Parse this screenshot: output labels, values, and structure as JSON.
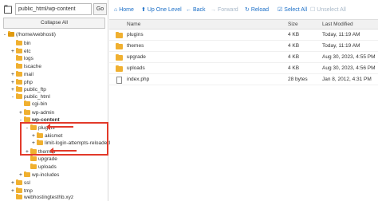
{
  "path_bar": {
    "value": "public_html/wp-content",
    "go_label": "Go"
  },
  "collapse_label": "Collapse All",
  "tree": [
    {
      "toggle": "-",
      "label": "(/home/webhosti)",
      "bold": false
    },
    {
      "toggle": "",
      "label": "bin",
      "bold": false
    },
    {
      "toggle": "+",
      "label": "etc",
      "bold": false
    },
    {
      "toggle": "",
      "label": "logs",
      "bold": false
    },
    {
      "toggle": "",
      "label": "lscache",
      "bold": false
    },
    {
      "toggle": "+",
      "label": "mail",
      "bold": false
    },
    {
      "toggle": "+",
      "label": "php",
      "bold": false
    },
    {
      "toggle": "+",
      "label": "public_ftp",
      "bold": false
    },
    {
      "toggle": "-",
      "label": "public_html",
      "bold": false
    },
    {
      "toggle": "",
      "label": "cgi-bin",
      "bold": false
    },
    {
      "toggle": "+",
      "label": "wp-admin",
      "bold": false
    },
    {
      "toggle": "-",
      "label": "wp-content",
      "bold": true
    },
    {
      "toggle": "-",
      "label": "plugins",
      "bold": false
    },
    {
      "toggle": "+",
      "label": "akismet",
      "bold": false
    },
    {
      "toggle": "+",
      "label": "limit-login-attempts-reloaded",
      "bold": false
    },
    {
      "toggle": "+",
      "label": "themes",
      "bold": false
    },
    {
      "toggle": "",
      "label": "upgrade",
      "bold": false
    },
    {
      "toggle": "",
      "label": "uploads",
      "bold": false
    },
    {
      "toggle": "+",
      "label": "wp-includes",
      "bold": false
    },
    {
      "toggle": "+",
      "label": "ssl",
      "bold": false
    },
    {
      "toggle": "+",
      "label": "tmp",
      "bold": false
    },
    {
      "toggle": "",
      "label": "webhostingtesthb.xyz",
      "bold": false
    }
  ],
  "toolbar": [
    {
      "icon": "home-icon",
      "glyph": "⌂",
      "label": "Home",
      "enabled": true
    },
    {
      "icon": "up-level-icon",
      "glyph": "⬆",
      "label": "Up One Level",
      "enabled": true
    },
    {
      "icon": "back-icon",
      "glyph": "←",
      "label": "Back",
      "enabled": true
    },
    {
      "icon": "forward-icon",
      "glyph": "→",
      "label": "Forward",
      "enabled": false
    },
    {
      "icon": "reload-icon",
      "glyph": "↻",
      "label": "Reload",
      "enabled": true
    },
    {
      "icon": "select-all-icon",
      "glyph": "☑",
      "label": "Select All",
      "enabled": true
    },
    {
      "icon": "unselect-all-icon",
      "glyph": "☐",
      "label": "Unselect All",
      "enabled": false
    }
  ],
  "list": {
    "headers": {
      "name": "Name",
      "size": "Size",
      "modified": "Last Modified"
    },
    "rows": [
      {
        "type": "folder",
        "name": "plugins",
        "size": "4 KB",
        "modified": "Today, 11:19 AM"
      },
      {
        "type": "folder",
        "name": "themes",
        "size": "4 KB",
        "modified": "Today, 11:19 AM"
      },
      {
        "type": "folder",
        "name": "upgrade",
        "size": "4 KB",
        "modified": "Aug 30, 2023, 4:55 PM"
      },
      {
        "type": "folder",
        "name": "uploads",
        "size": "4 KB",
        "modified": "Aug 30, 2023, 4:56 PM"
      },
      {
        "type": "php",
        "name": "index.php",
        "size": "28 bytes",
        "modified": "Jan 8, 2012, 4:31 PM"
      }
    ]
  },
  "colors": {
    "accent": "#1a6ec7",
    "annotation": "#e23a2a",
    "folder": "#f0b030"
  }
}
